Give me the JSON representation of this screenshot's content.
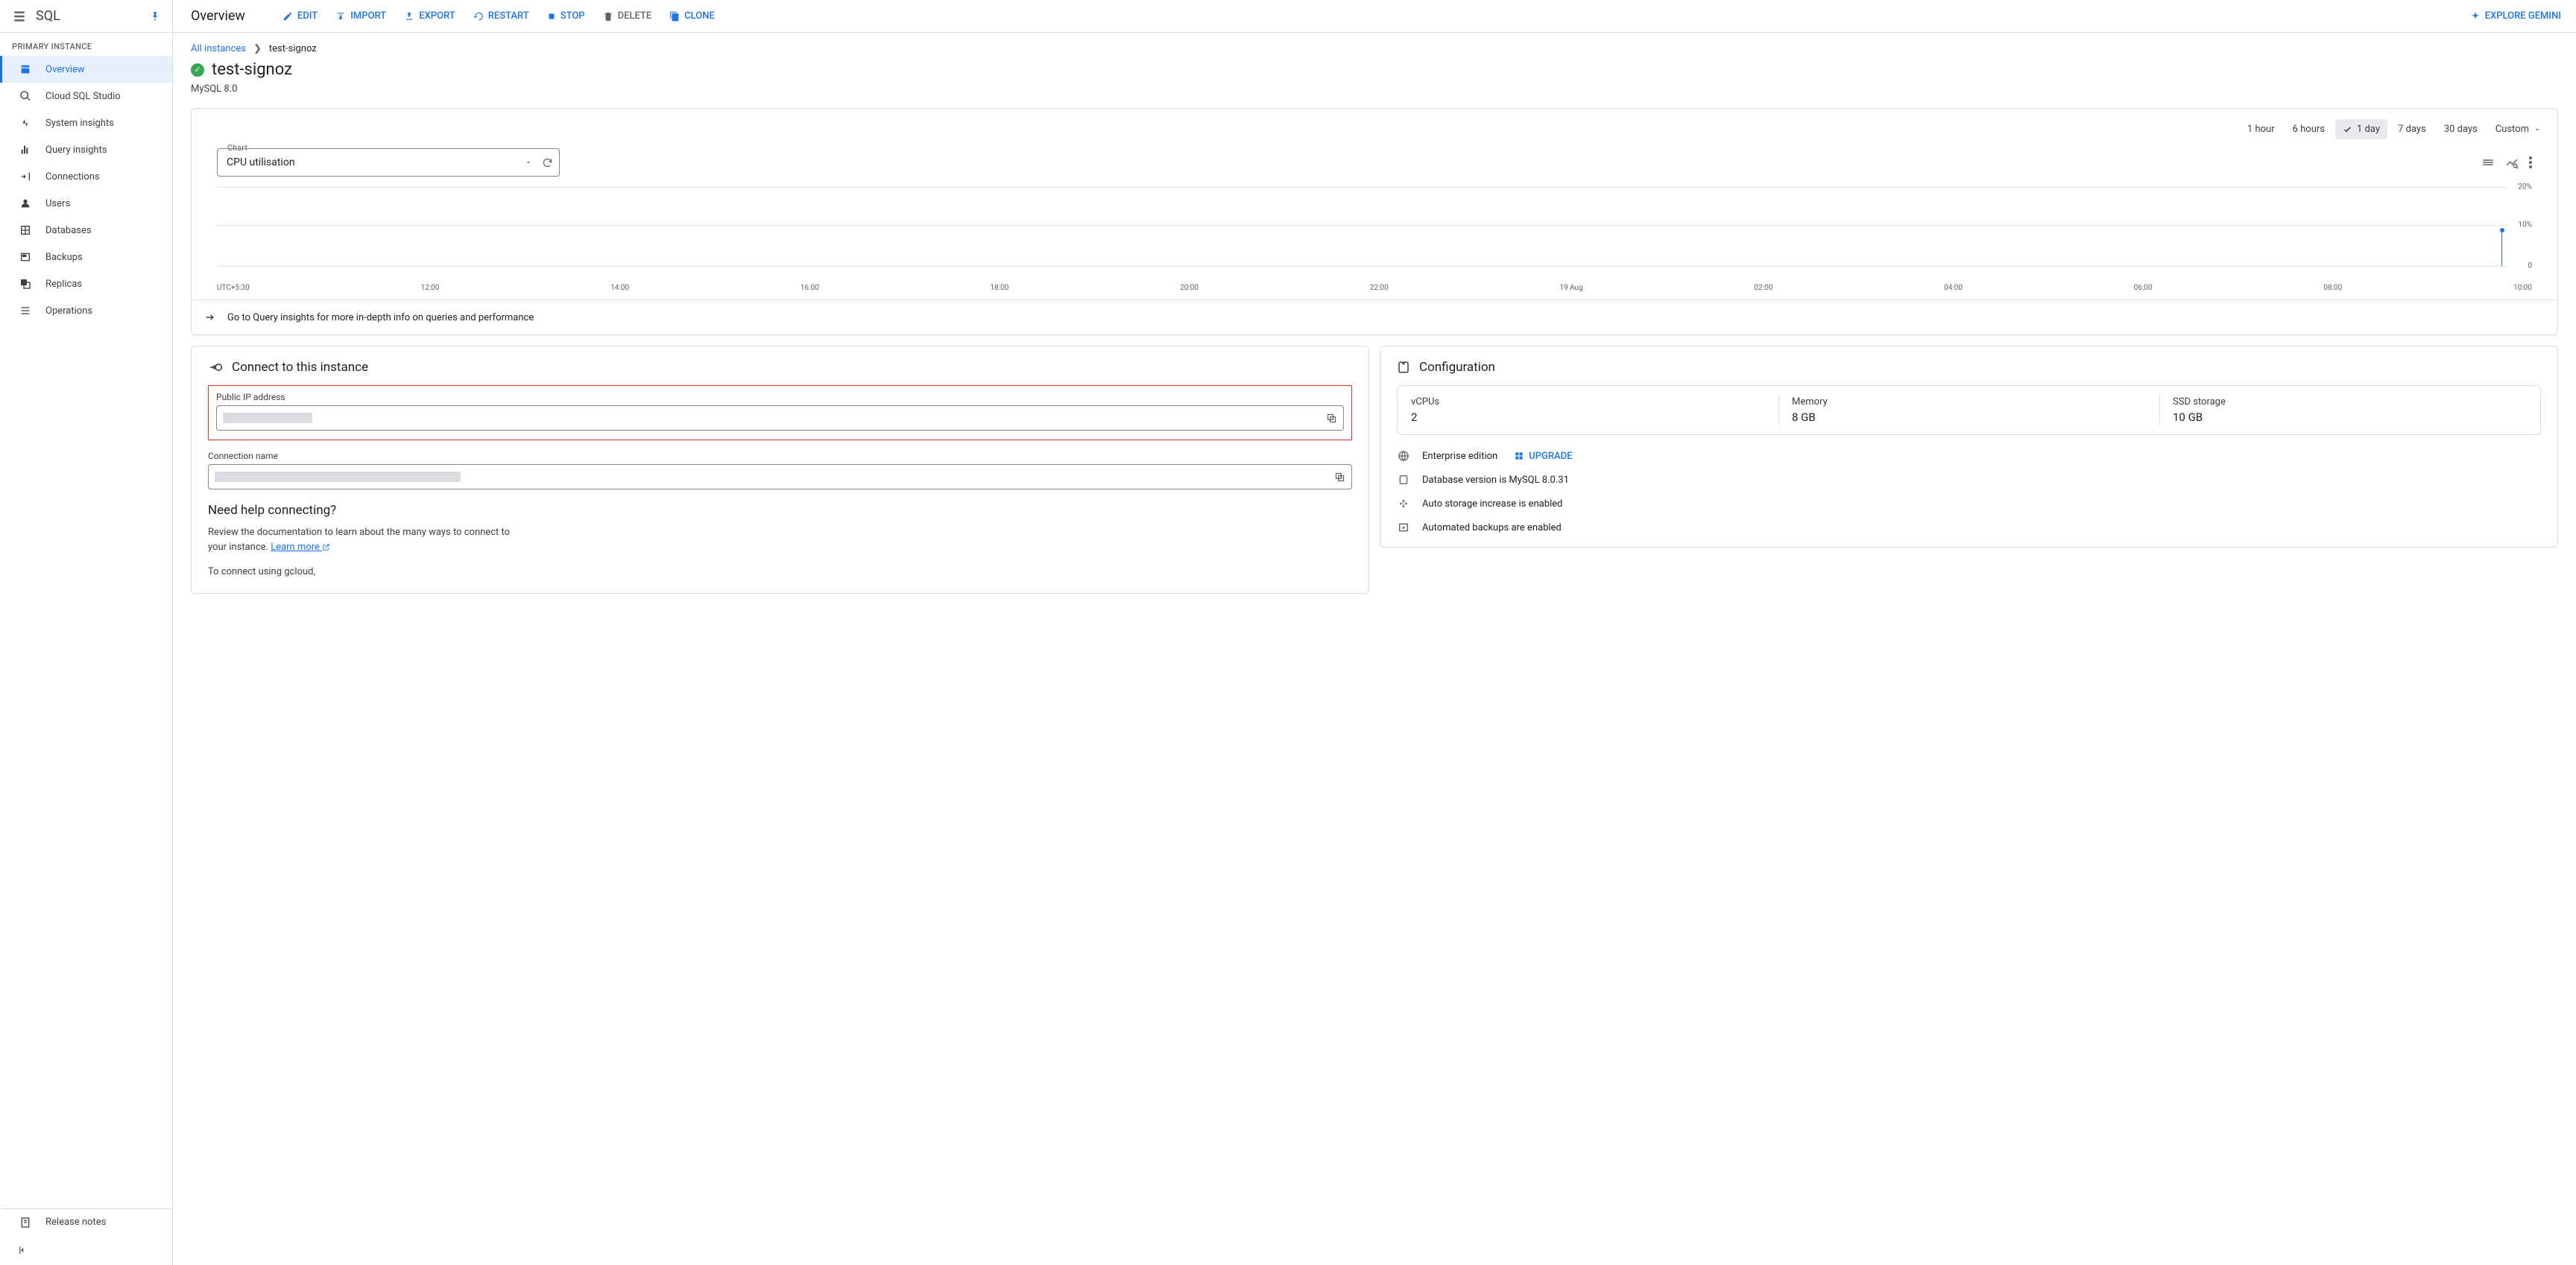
{
  "product": {
    "name": "SQL"
  },
  "page_title": "Overview",
  "header_actions": {
    "edit": "Edit",
    "import": "Import",
    "export": "Export",
    "restart": "Restart",
    "stop": "Stop",
    "delete": "Delete",
    "clone": "Clone",
    "explore_gemini": "Explore Gemini"
  },
  "sidebar": {
    "section": "Primary instance",
    "items": [
      {
        "label": "Overview"
      },
      {
        "label": "Cloud SQL Studio"
      },
      {
        "label": "System insights"
      },
      {
        "label": "Query insights"
      },
      {
        "label": "Connections"
      },
      {
        "label": "Users"
      },
      {
        "label": "Databases"
      },
      {
        "label": "Backups"
      },
      {
        "label": "Replicas"
      },
      {
        "label": "Operations"
      }
    ],
    "release_notes": "Release notes"
  },
  "breadcrumb": {
    "root": "All instances",
    "current": "test-signoz"
  },
  "instance": {
    "name": "test-signoz",
    "engine": "MySQL 8.0"
  },
  "chart": {
    "select_label": "Chart",
    "metric": "CPU utilisation",
    "ranges": [
      "1 hour",
      "6 hours",
      "1 day",
      "7 days",
      "30 days",
      "Custom"
    ],
    "active_range": 2,
    "insights_link": "Go to Query insights for more in-depth info on queries and performance"
  },
  "chart_data": {
    "type": "line",
    "title": "CPU utilisation",
    "timezone_label": "UTC+5:30",
    "x_ticks": [
      "12:00",
      "14:00",
      "16:00",
      "18:00",
      "20:00",
      "22:00",
      "19 Aug",
      "02:00",
      "04:00",
      "06:00",
      "08:00",
      "10:00"
    ],
    "y_ticks": [
      {
        "label": "0",
        "pct": 0
      },
      {
        "label": "10%",
        "pct": 50
      },
      {
        "label": "20%",
        "pct": 100
      }
    ],
    "ylim": [
      0,
      20
    ],
    "series": [
      {
        "name": "CPU utilisation",
        "x_frac": 0.985,
        "value": 9,
        "unit": "%"
      }
    ]
  },
  "connect_panel": {
    "title": "Connect to this instance",
    "public_ip_label": "Public IP address",
    "conn_name_label": "Connection name",
    "help_title": "Need help connecting?",
    "help_body": "Review the documentation to learn about the many ways to connect to your instance.",
    "learn_more": "Learn more",
    "gcloud_line": "To connect using gcloud,"
  },
  "config_panel": {
    "title": "Configuration",
    "stats": [
      {
        "k": "vCPUs",
        "v": "2"
      },
      {
        "k": "Memory",
        "v": "8 GB"
      },
      {
        "k": "SSD storage",
        "v": "10 GB"
      }
    ],
    "rows": {
      "edition": "Enterprise edition",
      "upgrade": "Upgrade",
      "db_version": "Database version is MySQL 8.0.31",
      "auto_storage": "Auto storage increase is enabled",
      "auto_backup": "Automated backups are enabled"
    }
  }
}
